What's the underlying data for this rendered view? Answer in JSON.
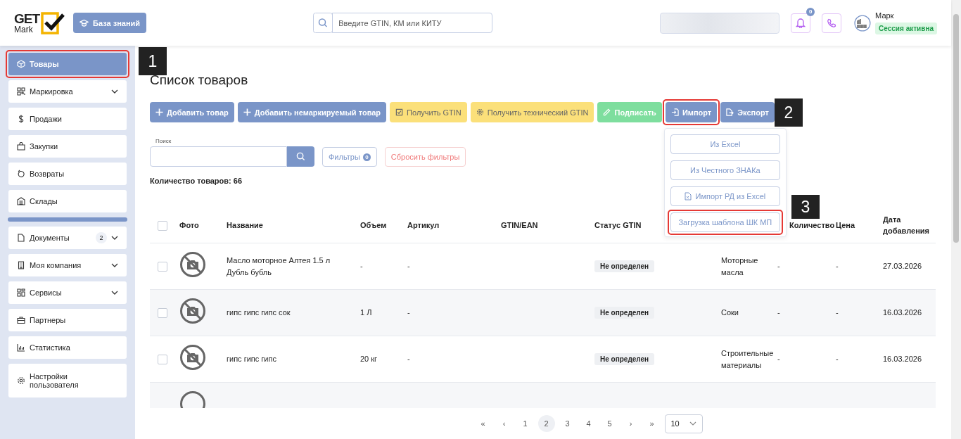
{
  "header": {
    "logo_top": "GET",
    "logo_bottom": "Mark",
    "kb_button": "База знаний",
    "search": {
      "placeholder": "Введите GTIN, КМ или КИТУ"
    },
    "notifications_count": "0",
    "user": {
      "name": "Марк",
      "session": "Сессия активна"
    }
  },
  "sidebar": {
    "groups": [
      [
        {
          "label": "Товары",
          "selected": true,
          "expandable": false,
          "highlighted": true,
          "annotation": "1"
        },
        {
          "label": "Маркировка",
          "selected": false,
          "expandable": true,
          "highlighted": false
        },
        {
          "label": "Продажи",
          "selected": false,
          "expandable": false,
          "highlighted": false
        },
        {
          "label": "Закупки",
          "selected": false,
          "expandable": false,
          "highlighted": false
        },
        {
          "label": "Возвраты",
          "selected": false,
          "expandable": false,
          "highlighted": false
        },
        {
          "label": "Склады",
          "selected": false,
          "expandable": false,
          "highlighted": false
        }
      ],
      [
        {
          "label": "Документы",
          "selected": false,
          "expandable": true,
          "highlighted": false,
          "badge": "2"
        },
        {
          "label": "Моя компания",
          "selected": false,
          "expandable": true,
          "highlighted": false
        },
        {
          "label": "Сервисы",
          "selected": false,
          "expandable": true,
          "highlighted": false
        },
        {
          "label": "Партнеры",
          "selected": false,
          "expandable": false,
          "highlighted": false
        },
        {
          "label": "Статистика",
          "selected": false,
          "expandable": false,
          "highlighted": false
        },
        {
          "label": "Настройки пользователя",
          "selected": false,
          "expandable": false,
          "highlighted": false
        }
      ]
    ]
  },
  "page_title": "Список товаров",
  "toolbar": [
    {
      "label": "Добавить товар",
      "kind": "primary",
      "highlighted": false
    },
    {
      "label": "Добавить немаркируемый товар",
      "kind": "primary",
      "highlighted": false
    },
    {
      "label": "Получить GTIN",
      "kind": "warning",
      "highlighted": false
    },
    {
      "label": "Получить технический GTIN",
      "kind": "warning",
      "highlighted": false
    },
    {
      "label": "Подписать",
      "kind": "success",
      "highlighted": false
    },
    {
      "label": "Импорт",
      "kind": "primary",
      "highlighted": true,
      "annotation": "2"
    },
    {
      "label": "Экспорт",
      "kind": "primary",
      "highlighted": false
    }
  ],
  "import_menu": [
    {
      "label": "Из Excel",
      "highlighted": false
    },
    {
      "label": "Из Честного ЗНАКа",
      "highlighted": false
    },
    {
      "label": "Импорт РД из Excel",
      "highlighted": false
    },
    {
      "label": "Загрузка шаблона ШК МП",
      "highlighted": true,
      "annotation": "3"
    }
  ],
  "filters": {
    "search_label": "Поиск",
    "filters_button": "Фильтры",
    "filters_count": "0",
    "reset_button": "Сбросить фильтры",
    "total": "Количество товаров: 66"
  },
  "table": {
    "all_checked": false,
    "columns": [
      "Фото",
      "Название",
      "Объем",
      "Артикул",
      "GTIN/EAN",
      "Статус GTIN",
      "Количество",
      "Цена",
      "Дата добавления"
    ],
    "rows": [
      {
        "checked": false,
        "name": "Масло моторное Алтея 1.5 л Дубль бубль",
        "volume": "-",
        "article": "-",
        "status": "Не определен",
        "category": "Моторные масла",
        "quantity": "-",
        "price": "-",
        "date": "27.03.2026"
      },
      {
        "checked": false,
        "name": "гипс гипс гипс сок",
        "volume": "1 Л",
        "article": "-",
        "status": "Не определен",
        "category": "Соки",
        "quantity": "-",
        "price": "-",
        "date": "16.03.2026"
      },
      {
        "checked": false,
        "name": "гипс гипс гипс",
        "volume": "20 кг",
        "article": "-",
        "status": "Не определен",
        "category": "Строительные материалы",
        "quantity": "-",
        "price": "-",
        "date": "16.03.2026"
      }
    ]
  },
  "pagination": {
    "first": "«",
    "prev": "‹",
    "pages": [
      {
        "label": "1",
        "selected": false
      },
      {
        "label": "2",
        "selected": true
      },
      {
        "label": "3",
        "selected": false
      },
      {
        "label": "4",
        "selected": false
      },
      {
        "label": "5",
        "selected": false
      }
    ],
    "next": "›",
    "last": "»",
    "page_size": "10"
  }
}
